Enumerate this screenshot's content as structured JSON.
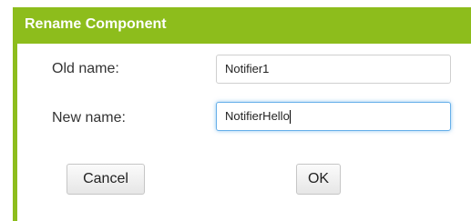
{
  "dialog": {
    "title": "Rename Component"
  },
  "form": {
    "old_name_label": "Old name:",
    "old_name_value": "Notifier1",
    "new_name_label": "New name:",
    "new_name_value": "NotifierHello"
  },
  "actions": {
    "cancel_label": "Cancel",
    "ok_label": "OK"
  },
  "colors": {
    "accent": "#8dbd1c",
    "focus_ring": "#66afe9"
  }
}
